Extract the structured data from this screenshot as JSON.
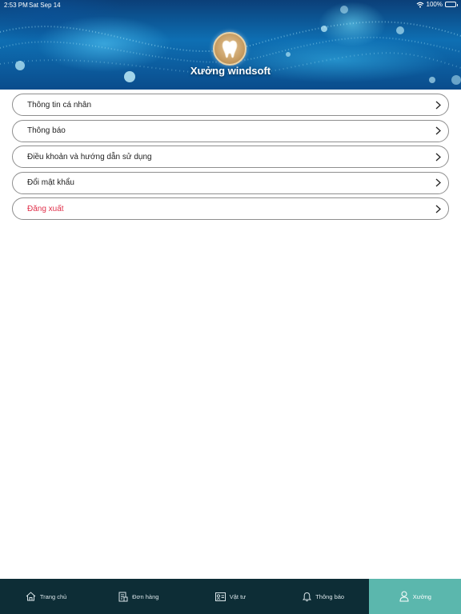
{
  "status_bar": {
    "time": "2:53 PM",
    "date": "Sat Sep 14",
    "battery": "100%",
    "icons": [
      "wifi-icon",
      "battery-icon"
    ]
  },
  "header": {
    "title": "Xưởng windsoft",
    "avatar_icon": "tooth-icon"
  },
  "menu": {
    "items": [
      {
        "label": "Thông tin cá nhân",
        "icon": "chevron-right-icon"
      },
      {
        "label": "Thông báo",
        "icon": "chevron-right-icon"
      },
      {
        "label": "Điều khoản và hướng dẫn sử dụng",
        "icon": "chevron-right-icon"
      },
      {
        "label": "Đổi mật khẩu",
        "icon": "chevron-right-icon"
      },
      {
        "label": "Đăng xuất",
        "icon": "chevron-right-icon",
        "color": "#e0304a"
      }
    ]
  },
  "tabbar": {
    "items": [
      {
        "label": "Trang chủ",
        "icon": "home-icon",
        "active": false
      },
      {
        "label": "Đơn hàng",
        "icon": "order-icon",
        "active": false
      },
      {
        "label": "Vật tư",
        "icon": "supplies-icon",
        "active": false
      },
      {
        "label": "Thông báo",
        "icon": "bell-icon",
        "active": false
      },
      {
        "label": "Xưởng",
        "icon": "user-icon",
        "active": true
      }
    ],
    "background": "#0d2d36",
    "active_color": "#5bb7ad"
  }
}
